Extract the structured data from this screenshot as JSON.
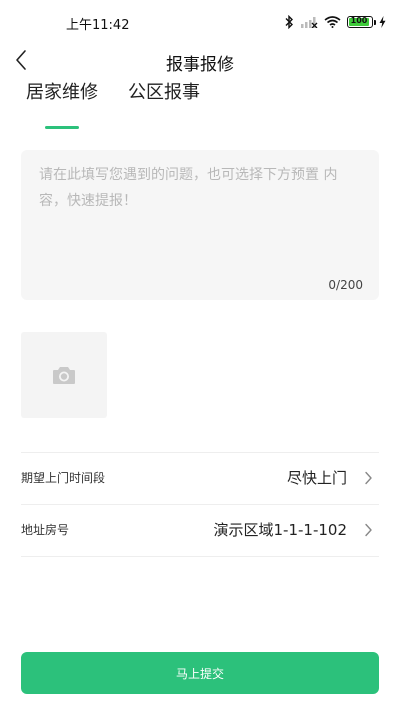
{
  "status_bar": {
    "time": "上午11:42",
    "battery_level": "100",
    "icons": [
      "bluetooth-icon",
      "signal-icon",
      "wifi-icon",
      "battery-icon",
      "charging-icon"
    ]
  },
  "header": {
    "title": "报事报修",
    "back_icon": "chevron-left-icon"
  },
  "tabs": [
    {
      "label": "居家维修",
      "active": true
    },
    {
      "label": "公区报事",
      "active": false
    }
  ],
  "description": {
    "value": "",
    "placeholder": "请在此填写您遇到的问题，也可选择下方预置 内容，快速提报！",
    "char_count": "0/200"
  },
  "photo_upload": {
    "icon": "camera-icon"
  },
  "form": {
    "time_label": "期望上门时间段",
    "time_value": "尽快上门",
    "address_label": "地址房号",
    "address_value": "演示区域1-1-1-102"
  },
  "submit": {
    "label": "马上提交"
  },
  "colors": {
    "accent": "#2cc17b",
    "input_bg": "#f6f6f6",
    "placeholder": "#b8b8b8"
  }
}
